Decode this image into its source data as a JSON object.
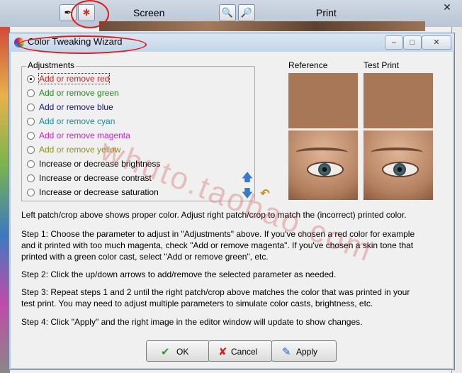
{
  "background": {
    "screen_label": "Screen",
    "print_label": "Print",
    "zoom_out_icon": "zoom-out-icon",
    "zoom_in_icon": "zoom-in-icon",
    "close_glyph": "✕"
  },
  "dialog": {
    "title": "Color Tweaking Wizard",
    "window_buttons": {
      "minimize": "–",
      "maximize": "□",
      "close": "✕"
    },
    "adjustments": {
      "legend": "Adjustments",
      "options": [
        {
          "label": "Add or remove red",
          "color": "#d21d1d",
          "checked": true
        },
        {
          "label": "Add or remove green",
          "color": "#1f8a1f",
          "checked": false
        },
        {
          "label": "Add or remove blue",
          "color": "#14147a",
          "checked": false
        },
        {
          "label": "Add or remove cyan",
          "color": "#178d9b",
          "checked": false
        },
        {
          "label": "Add or remove magenta",
          "color": "#d21dd2",
          "checked": false
        },
        {
          "label": "Add or remove yellow",
          "color": "#8d8d1f",
          "checked": false
        },
        {
          "label": "Increase or decrease brightness",
          "color": "#000000",
          "checked": false
        },
        {
          "label": "Increase or decrease contrast",
          "color": "#000000",
          "checked": false
        },
        {
          "label": "Increase or decrease saturation",
          "color": "#000000",
          "checked": false
        }
      ]
    },
    "up_arrow": "🡅",
    "down_arrow": "🡇",
    "reset_arrow": "↶",
    "reference_label": "Reference",
    "test_print_label": "Test Print",
    "swatch_color": "#a87757",
    "instructions": {
      "intro": "Left patch/crop above shows proper color.  Adjust right patch/crop to match the (incorrect) printed color.",
      "step1": [
        "Step 1: Choose the parameter to adjust in \"Adjustments\" above.  If you've chosen a red color for example",
        "and it printed with too much magenta, check \"Add or remove magenta\".  If you've chosen a skin tone that",
        "printed with a green color cast, select \"Add or remove green\", etc."
      ],
      "step2": "Step 2: Click the up/down arrows to add/remove the selected parameter as needed.",
      "step3": [
        "Step 3: Repeat steps 1 and 2 until the right patch/crop above matches the color that was printed in your",
        "test print.  You may need to adjust multiple parameters to simulate color casts, brightness, etc."
      ],
      "step4": "Step 4: Click \"Apply\" and the right image in the editor window will update to show changes."
    },
    "buttons": {
      "ok": {
        "label": "OK",
        "icon": "✔"
      },
      "cancel": {
        "label": "Cancel",
        "icon": "✘"
      },
      "apply": {
        "label": "Apply",
        "icon": "✎"
      }
    },
    "watermark": "whuto.taobao.com"
  }
}
